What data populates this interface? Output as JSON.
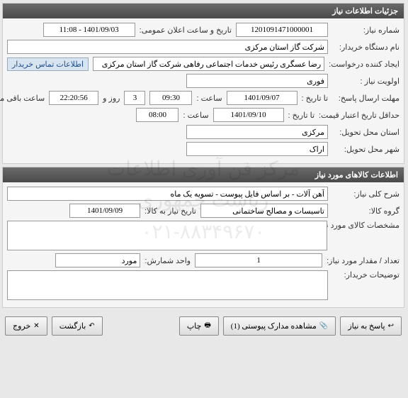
{
  "header1": "جزئیات اطلاعات نیاز",
  "need_num_label": "شماره نیاز:",
  "need_num": "1201091471000001",
  "announce_label": "تاریخ و ساعت اعلان عمومی:",
  "announce_val": "1401/09/03 - 11:08",
  "buyer_label": "نام دستگاه خریدار:",
  "buyer_val": "شرکت گاز استان مرکزی",
  "requester_label": "ایجاد کننده درخواست:",
  "requester_val": "رضا عسگری رئیس خدمات اجتماعی رفاهی شرکت گاز استان مرکزی",
  "contact_link": "اطلاعات تماس خریدار",
  "priority_label": "اولویت نیاز :",
  "priority_val": "فوری",
  "deadline_label": "مهلت ارسال پاسخ:",
  "until_label": "تا تاریخ :",
  "deadline_date": "1401/09/07",
  "time_label": "ساعت :",
  "deadline_time": "09:30",
  "days_val": "3",
  "days_label": "روز و",
  "remain_time": "22:20:56",
  "remain_label": "ساعت باقی مانده",
  "validity_label": "حداقل تاریخ اعتبار قیمت:",
  "validity_date": "1401/09/10",
  "validity_time": "08:00",
  "province_label": "استان محل تحویل:",
  "province_val": "مرکزی",
  "city_label": "شهر محل تحویل:",
  "city_val": "اراک",
  "header2": "اطلاعات کالاهای مورد نیاز",
  "desc_label": "شرح کلی نیاز:",
  "desc_val": "آهن آلات - بر اساس فایل پیوست - تسویه یک ماه",
  "group_label": "گروه کالا:",
  "group_val": "تاسیسات و مصالح ساختمانی",
  "need_date_label": "تاریخ نیاز به کالا:",
  "need_date_val": "1401/09/09",
  "spec_label": "مشخصات کالای مورد نیاز:",
  "spec_val": "",
  "qty_label": "تعداد / مقدار مورد نیاز:",
  "qty_val": "1",
  "unit_label": "واحد شمارش:",
  "unit_val": "مورد",
  "notes_label": "توضیحات خریدار:",
  "notes_val": "",
  "btn_respond": "پاسخ به نیاز",
  "btn_attach": "مشاهده مدارک پیوستی (1)",
  "btn_print": "چاپ",
  "btn_back": "بازگشت",
  "btn_exit": "خروج",
  "wm1": "مرکز فن آوری اطلاعات ریاست جمهوری",
  "wm2": "۰۲۱-۸۸۳۴۹۶۷۰"
}
